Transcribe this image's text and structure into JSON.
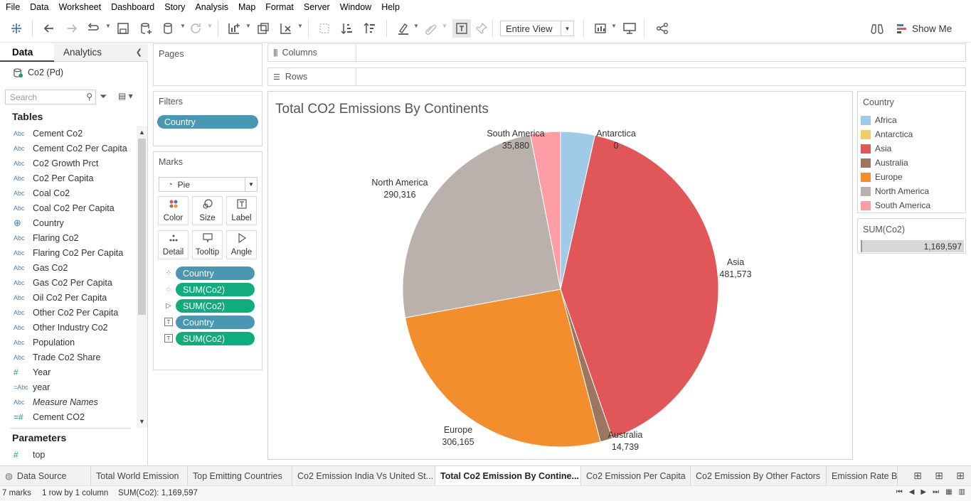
{
  "menu": [
    "File",
    "Data",
    "Worksheet",
    "Dashboard",
    "Story",
    "Analysis",
    "Map",
    "Format",
    "Server",
    "Window",
    "Help"
  ],
  "toolbar": {
    "fit_value": "Entire View",
    "show_me_label": "Show Me"
  },
  "data_pane": {
    "tab_data": "Data",
    "tab_analytics": "Analytics",
    "datasource": "Co2 (Pd)",
    "search_placeholder": "Search",
    "tables_title": "Tables",
    "fields": [
      {
        "type": "Abc",
        "name": "Cement Co2"
      },
      {
        "type": "Abc",
        "name": "Cement Co2 Per Capita"
      },
      {
        "type": "Abc",
        "name": "Co2 Growth Prct"
      },
      {
        "type": "Abc",
        "name": "Co2 Per Capita"
      },
      {
        "type": "Abc",
        "name": "Coal Co2"
      },
      {
        "type": "Abc",
        "name": "Coal Co2 Per Capita"
      },
      {
        "type": "geo",
        "name": "Country"
      },
      {
        "type": "Abc",
        "name": "Flaring Co2"
      },
      {
        "type": "Abc",
        "name": "Flaring Co2 Per Capita"
      },
      {
        "type": "Abc",
        "name": "Gas Co2"
      },
      {
        "type": "Abc",
        "name": "Gas Co2 Per Capita"
      },
      {
        "type": "Abc",
        "name": "Oil Co2 Per Capita"
      },
      {
        "type": "Abc",
        "name": "Other Co2 Per Capita"
      },
      {
        "type": "Abc",
        "name": "Other Industry Co2"
      },
      {
        "type": "Abc",
        "name": "Population"
      },
      {
        "type": "Abc",
        "name": "Trade Co2 Share"
      },
      {
        "type": "#",
        "name": "Year"
      },
      {
        "type": "=Abc",
        "name": "year"
      },
      {
        "type": "Abc",
        "name": "Measure Names",
        "italic": true
      },
      {
        "type": "=#",
        "name": "Cement CO2"
      }
    ],
    "parameters_title": "Parameters",
    "parameters": [
      {
        "type": "#",
        "name": "top"
      }
    ]
  },
  "shelves": {
    "pages": "Pages",
    "filters": "Filters",
    "filter_pill": "Country",
    "columns": "Columns",
    "rows": "Rows"
  },
  "marks": {
    "title": "Marks",
    "mark_type": "Pie",
    "buttons": [
      "Color",
      "Size",
      "Label",
      "Detail",
      "Tooltip",
      "Angle"
    ],
    "pills": [
      {
        "icon": "color",
        "label": "Country",
        "kind": "dimension"
      },
      {
        "icon": "size",
        "label": "SUM(Co2)",
        "kind": "measure"
      },
      {
        "icon": "angle",
        "label": "SUM(Co2)",
        "kind": "measure"
      },
      {
        "icon": "label",
        "label": "Country",
        "kind": "dimension"
      },
      {
        "icon": "label",
        "label": "SUM(Co2)",
        "kind": "measure"
      }
    ]
  },
  "view": {
    "title": "Total CO2 Emissions By Continents"
  },
  "chart_data": {
    "type": "pie",
    "title": "Total CO2 Emissions By Continents",
    "categories": [
      "Africa",
      "Antarctica",
      "Asia",
      "Australia",
      "Europe",
      "North America",
      "South America"
    ],
    "values": [
      40924,
      0,
      481573,
      14739,
      306165,
      290316,
      35880
    ],
    "value_labels": [
      "",
      "0",
      "481,573",
      "14,739",
      "306,165",
      "290,316",
      "35,880"
    ],
    "colors": [
      "#a0cbe8",
      "#f1ce63",
      "#e15759",
      "#9d7660",
      "#f28e2b",
      "#bab0ac",
      "#ff9da7"
    ],
    "total": 1169597,
    "legend_position": "right"
  },
  "legend": {
    "title": "Country",
    "items": [
      {
        "label": "Africa",
        "color": "#a0cbe8"
      },
      {
        "label": "Antarctica",
        "color": "#f1ce63"
      },
      {
        "label": "Asia",
        "color": "#e15759"
      },
      {
        "label": "Australia",
        "color": "#9d7660"
      },
      {
        "label": "Europe",
        "color": "#f28e2b"
      },
      {
        "label": "North America",
        "color": "#bab0ac"
      },
      {
        "label": "South America",
        "color": "#ff9da7"
      }
    ]
  },
  "size_legend": {
    "title": "SUM(Co2)",
    "value": "1,169,597"
  },
  "sheet_tabs": [
    {
      "label": "Data Source",
      "active": false
    },
    {
      "label": "Total World Emission",
      "active": false
    },
    {
      "label": "Top Emitting Countries",
      "active": false
    },
    {
      "label": "Co2 Emission India Vs United St...",
      "active": false
    },
    {
      "label": "Total Co2 Emission By Contine...",
      "active": true
    },
    {
      "label": "Co2 Emission Per Capita",
      "active": false
    },
    {
      "label": "Co2 Emission By Other Factors",
      "active": false
    },
    {
      "label": "Emission Rate By In",
      "active": false
    }
  ],
  "status": {
    "marks": "7 marks",
    "rows_cols": "1 row by 1 column",
    "sum": "SUM(Co2): 1,169,597"
  }
}
